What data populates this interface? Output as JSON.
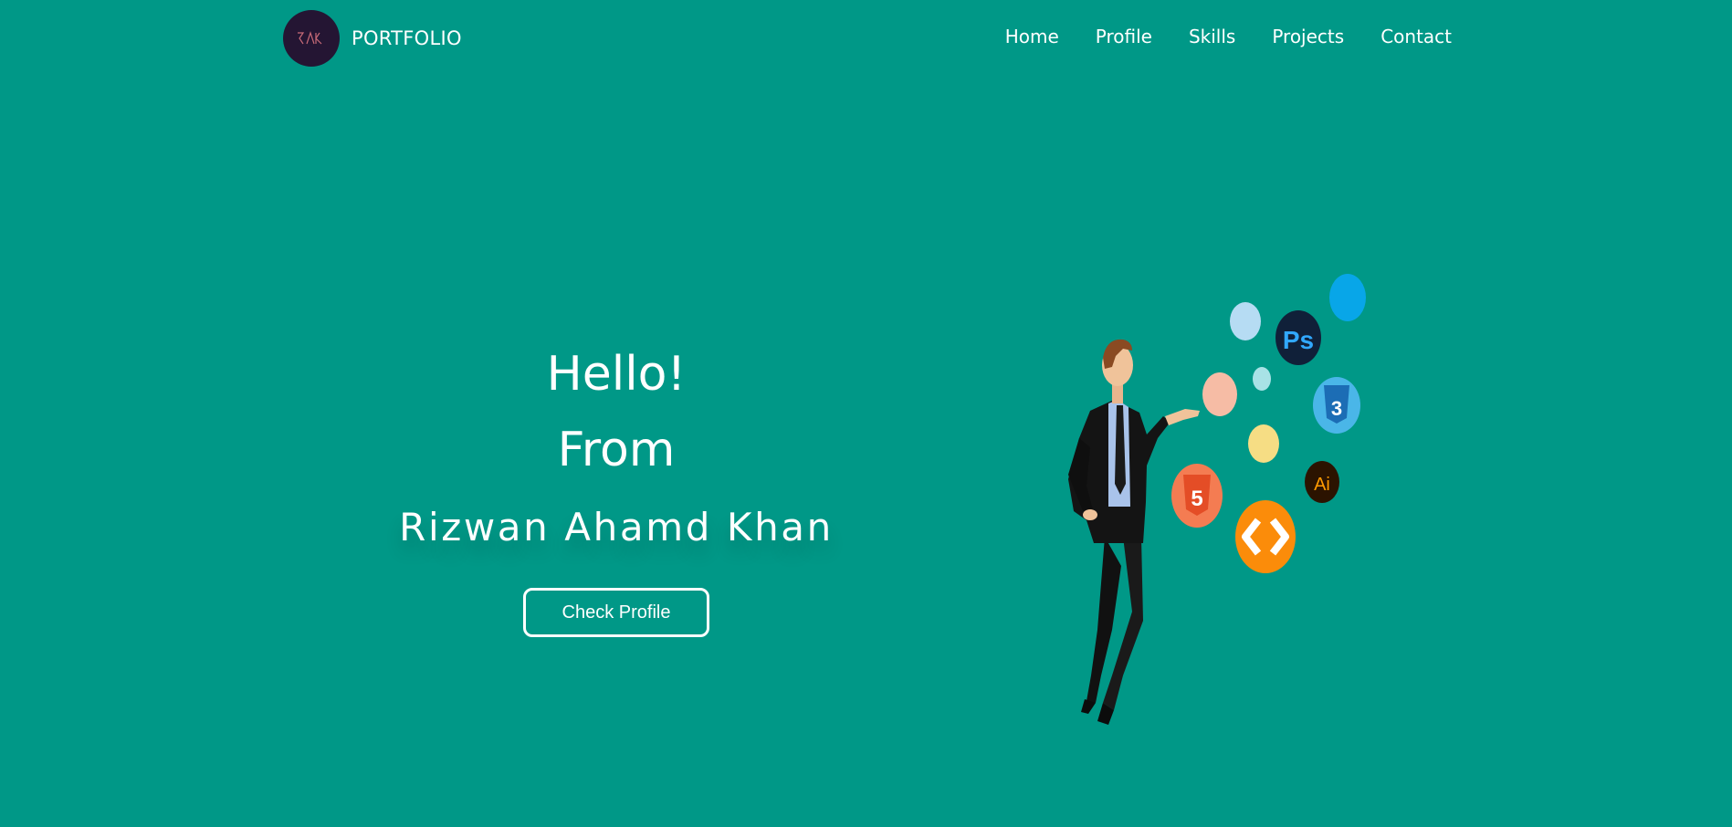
{
  "header": {
    "logo_text": "RAK",
    "brand": "PORTFOLIO",
    "nav": [
      "Home",
      "Profile",
      "Skills",
      "Projects",
      "Contact"
    ]
  },
  "hero": {
    "line1": "Hello!",
    "line2": "From",
    "name": "Rizwan Ahamd Khan",
    "cta_label": "Check Profile"
  },
  "illustration": {
    "badges": {
      "ps": "Ps",
      "css": "3",
      "html": "5",
      "ai": "Ai"
    },
    "icons": [
      "man-figure-icon",
      "photoshop-icon",
      "css3-icon",
      "html5-icon",
      "illustrator-icon",
      "code-brackets-icon"
    ]
  },
  "colors": {
    "background": "#009887",
    "logo_bg": "#241533",
    "text": "#ffffff"
  }
}
